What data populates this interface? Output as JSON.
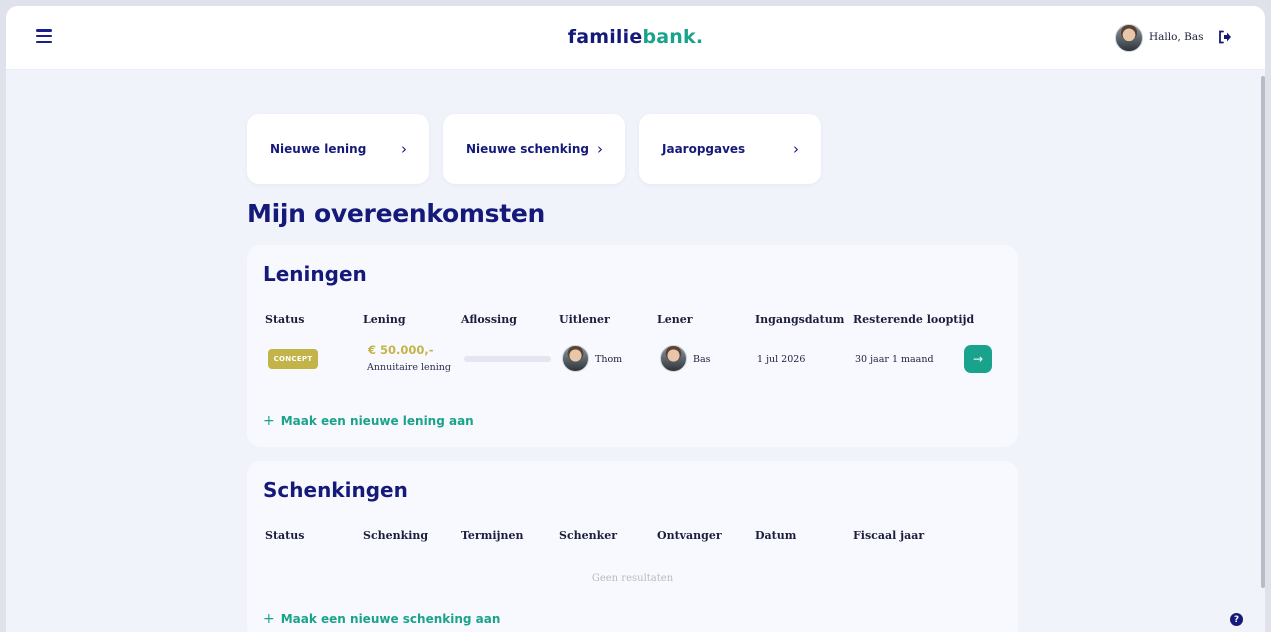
{
  "header": {
    "brand_main": "familie",
    "brand_accent": "bank",
    "brand_dot": ".",
    "greeting": "Hallo, Bas",
    "menu_icon": "hamburger-icon",
    "logout_icon": "logout-icon"
  },
  "quick_actions": [
    {
      "label": "Nieuwe lening",
      "chevron": "›"
    },
    {
      "label": "Nieuwe schenking",
      "chevron": "›"
    },
    {
      "label": "Jaaropgaves",
      "chevron": "›"
    }
  ],
  "page_title": "Mijn overeenkomsten",
  "loans": {
    "title": "Leningen",
    "columns": [
      "Status",
      "Lening",
      "Aflossing",
      "Uitlener",
      "Lener",
      "Ingangsdatum",
      "Resterende looptijd"
    ],
    "rows": [
      {
        "status": "CONCEPT",
        "amount": "€ 50.000,-",
        "loan_type": "Annuitaire lening",
        "repayment_progress": 0,
        "lender": "Thom",
        "borrower": "Bas",
        "start_date": "1 jul 2026",
        "remaining_term": "30 jaar 1 maand",
        "open_icon": "→"
      }
    ],
    "add_label": "Maak een nieuwe lening aan",
    "add_icon": "+"
  },
  "gifts": {
    "title": "Schenkingen",
    "columns": [
      "Status",
      "Schenking",
      "Termijnen",
      "Schenker",
      "Ontvanger",
      "Datum",
      "Fiscaal jaar"
    ],
    "empty_text": "Geen resultaten",
    "add_label": "Maak een nieuwe schenking aan",
    "add_icon": "+"
  },
  "help_icon": "?",
  "colors": {
    "brand": "#151a7a",
    "accent": "#1aa38c",
    "concept_badge": "#c3b44a",
    "background": "#f1f3fb"
  }
}
